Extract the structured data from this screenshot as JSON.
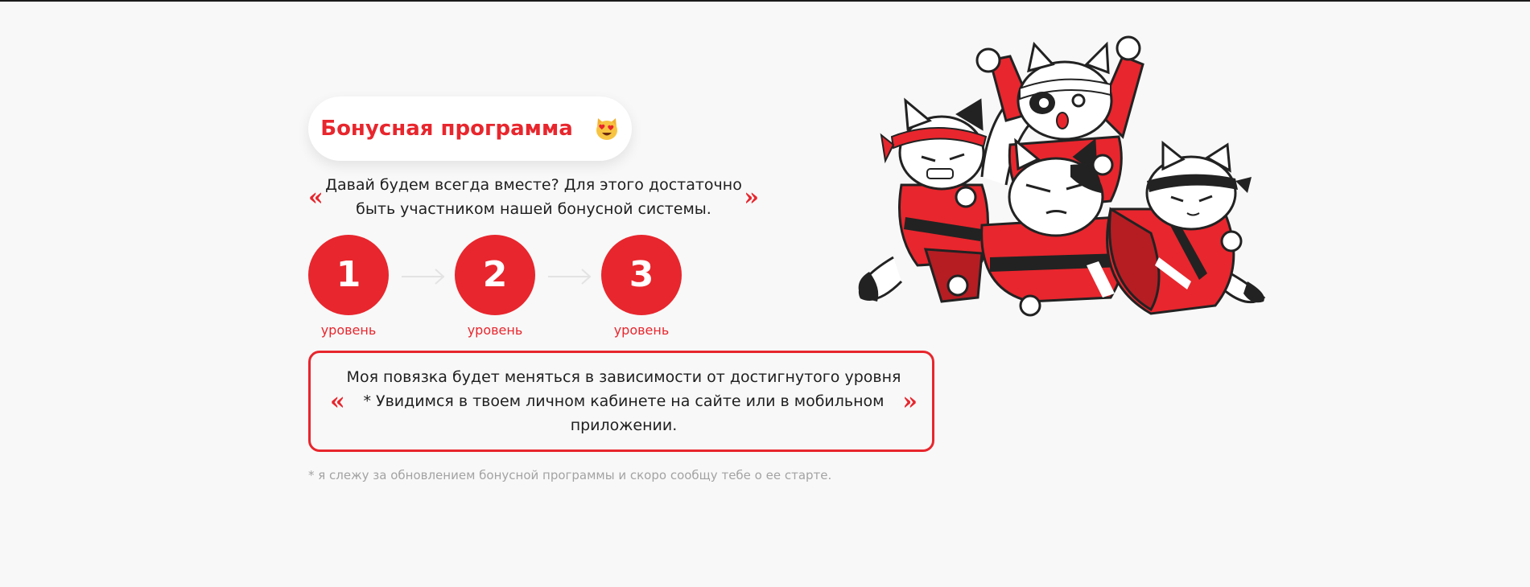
{
  "title": "Бонусная программа",
  "title_emoji": "heart-eyes-cat-emoji",
  "quote": {
    "open": "«",
    "close": "»",
    "text": "Давай будем всегда вместе? Для этого достаточно быть участником нашей бонусной системы."
  },
  "levels": [
    {
      "number": "1",
      "label": "уровень"
    },
    {
      "number": "2",
      "label": "уровень"
    },
    {
      "number": "3",
      "label": "уровень"
    }
  ],
  "note": {
    "open": "«",
    "close": "»",
    "text": "Моя повязка будет меняться в зависимости от достигнутого уровня * Увидимся в твоем личном кабинете на сайте или в мобильном приложении."
  },
  "footnote": "* я слежу за обновлением бонусной программы и скоро сообщу тебе о ее старте.",
  "colors": {
    "accent": "#e8262d",
    "background": "#f8f8f8",
    "text": "#1f1f1f",
    "muted": "#a3a3a3"
  },
  "illustration": "karate-cats-illustration"
}
